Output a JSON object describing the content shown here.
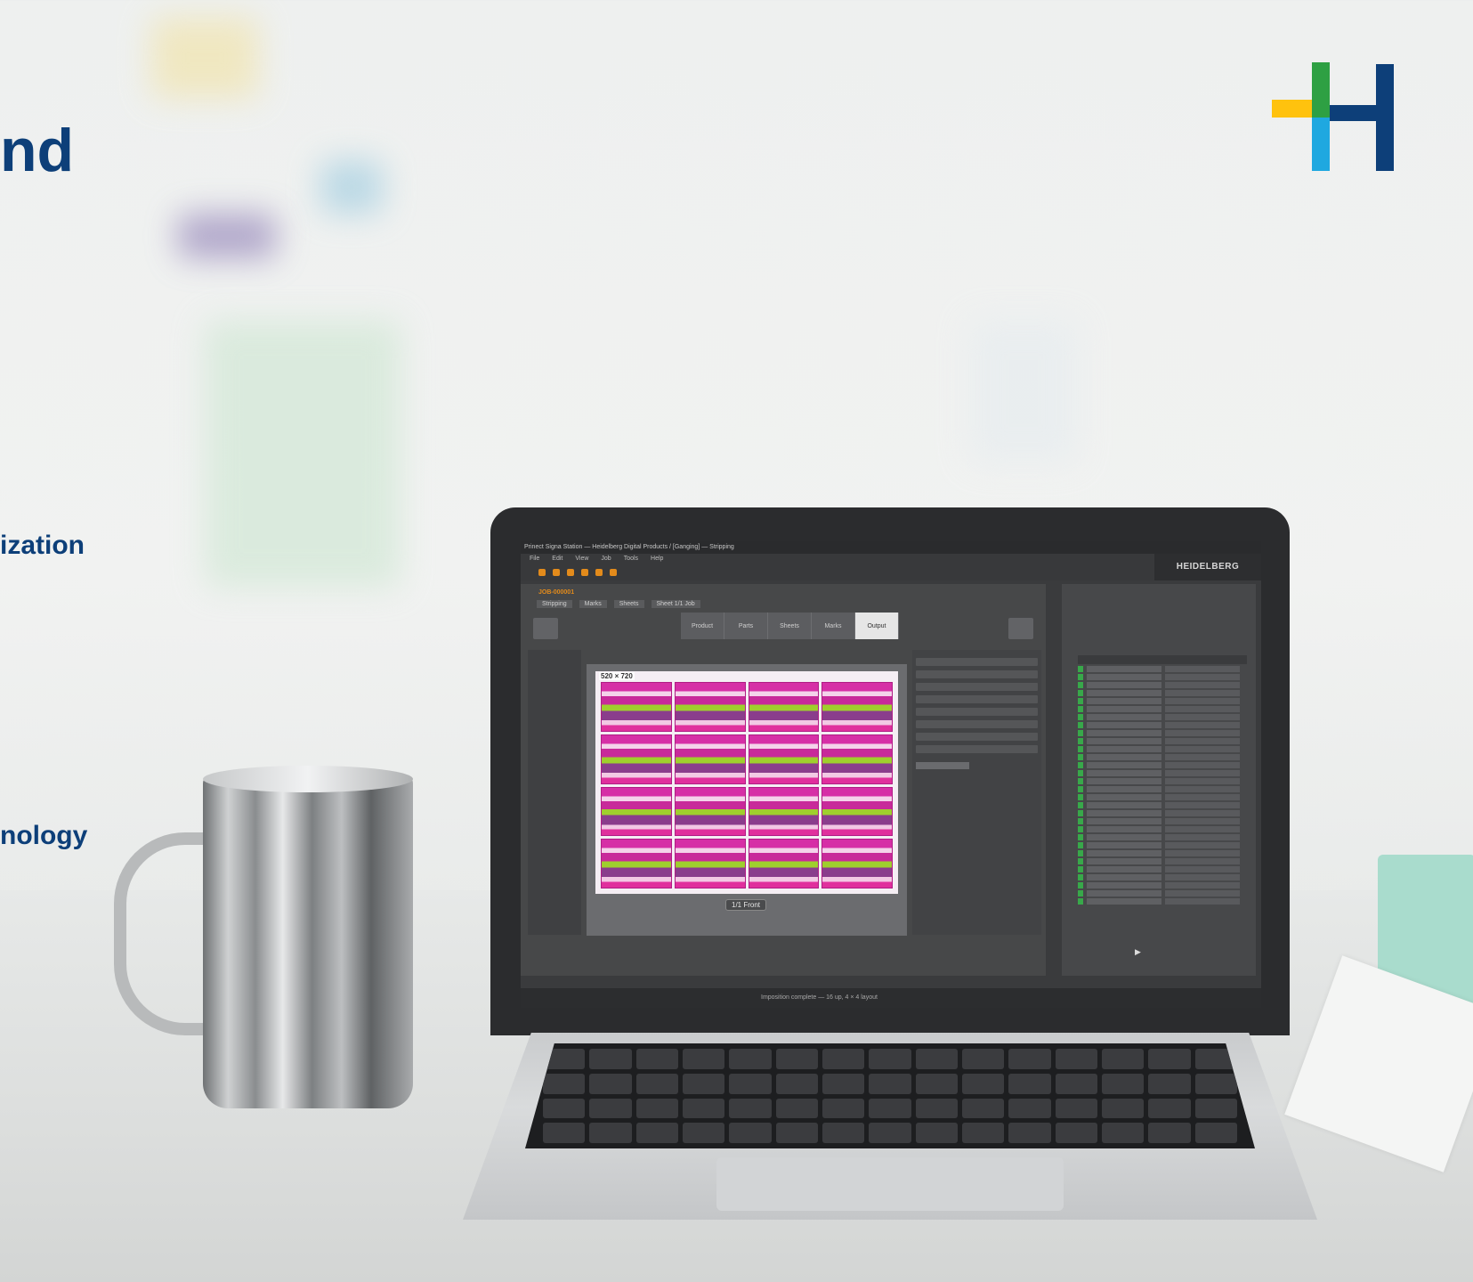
{
  "headline": "nd",
  "bullets": [
    "ization",
    "nology"
  ],
  "brand_colors": {
    "navy": "#0d3f79",
    "yellow": "#ffc20e",
    "green": "#2ea043",
    "cyan": "#1fa8e0"
  },
  "laptop": {
    "app": {
      "title_bar": "Prinect Signa Station — Heidelberg Digital Products / [Ganging] — Stripping",
      "menu": [
        "File",
        "Edit",
        "View",
        "Job",
        "Tools",
        "Help"
      ],
      "brand": "HEIDELBERG",
      "doc_tab": "JOB-000001",
      "tabs": [
        "Stripping",
        "Marks",
        "Sheets",
        "Sheet 1/1 Job"
      ],
      "workflow_steps": [
        "Product",
        "Parts",
        "Sheets",
        "Marks",
        "Output"
      ],
      "sheet_dimensions": "520 × 720",
      "frame_label": "1/1 Front",
      "status": "Imposition complete — 16 up, 4 × 4 layout"
    }
  }
}
